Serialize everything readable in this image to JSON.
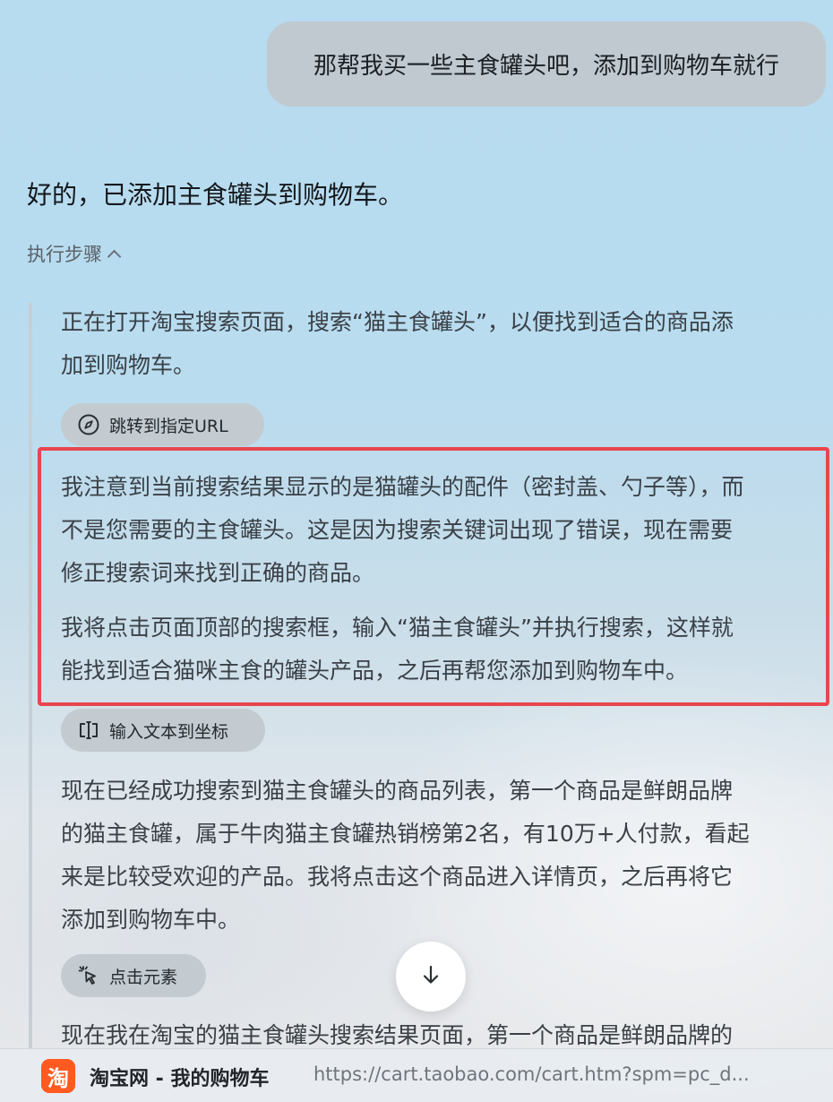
{
  "user_message": "那帮我买一些主食罐头吧，添加到购物车就行",
  "assistant_reply": "好的，已添加主食罐头到购物车。",
  "steps_toggle_label": "执行步骤",
  "steps": {
    "p1_line1": "正在打开淘宝搜索页面，搜索“猫主食罐头”，以便找到适合的商品添",
    "p1_line2": "加到购物车。",
    "chip1_label": "跳转到指定URL",
    "p2_line1": "我注意到当前搜索结果显示的是猫罐头的配件（密封盖、勺子等），而",
    "p2_line2": "不是您需要的主食罐头。这是因为搜索关键词出现了错误，现在需要",
    "p2_line3": "修正搜索词来找到正确的商品。",
    "p3_line1": "我将点击页面顶部的搜索框，输入“猫主食罐头”并执行搜索，这样就",
    "p3_line2": "能找到适合猫咪主食的罐头产品，之后再帮您添加到购物车中。",
    "chip2_label": "输入文本到坐标",
    "p4_line1": "现在已经成功搜索到猫主食罐头的商品列表，第一个商品是鲜朗品牌",
    "p4_line2": "的猫主食罐，属于牛肉猫主食罐热销榜第2名，有10万+人付款，看起",
    "p4_line3": "来是比较受欢迎的产品。我将点击这个商品进入详情页，之后再将它",
    "p4_line4": "添加到购物车中。",
    "chip3_label": "点击元素",
    "p5_line1": "现在我在淘宝的猫主食罐头搜索结果页面，第一个商品是鲜朗品牌的"
  },
  "tab": {
    "logo_char": "淘",
    "title": "淘宝网 - 我的购物车",
    "url": "https://cart.taobao.com/cart.htm?spm=pc_d..."
  },
  "colors": {
    "highlight_border": "#e8464e",
    "taobao_orange": "#ff5a1f"
  },
  "icons": [
    "compass-icon",
    "text-cursor-icon",
    "pointer-click-icon",
    "arrow-down-icon",
    "chevron-up-icon"
  ]
}
